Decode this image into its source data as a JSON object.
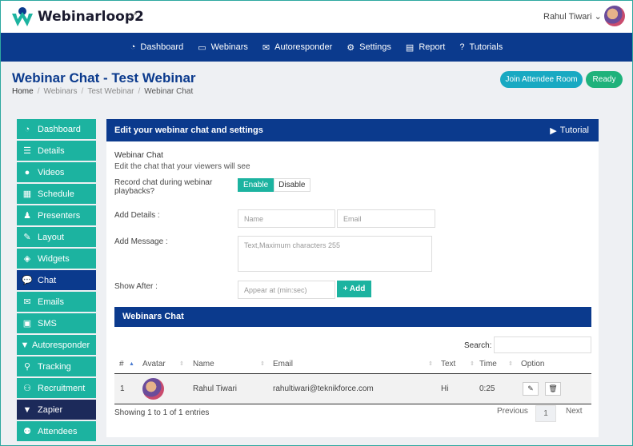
{
  "app": {
    "name": "Webinarloop2",
    "user": "Rahul Tiwari"
  },
  "nav": [
    {
      "label": "Dashboard",
      "icon": "dashboard-icon"
    },
    {
      "label": "Webinars",
      "icon": "webinars-icon"
    },
    {
      "label": "Autoresponder",
      "icon": "envelope-icon"
    },
    {
      "label": "Settings",
      "icon": "gear-icon"
    },
    {
      "label": "Report",
      "icon": "report-icon"
    },
    {
      "label": "Tutorials",
      "icon": "question-icon"
    }
  ],
  "header": {
    "title": "Webinar Chat - Test Webinar",
    "breadcrumb": [
      "Home",
      "Webinars",
      "Test Webinar",
      "Webinar Chat"
    ],
    "join_label": "Join Attendee Room",
    "ready_label": "Ready"
  },
  "sidebar": [
    {
      "label": "Dashboard",
      "icon": "dashboard-icon"
    },
    {
      "label": "Details",
      "icon": "list-icon"
    },
    {
      "label": "Videos",
      "icon": "video-icon"
    },
    {
      "label": "Schedule",
      "icon": "calendar-icon"
    },
    {
      "label": "Presenters",
      "icon": "presenter-icon"
    },
    {
      "label": "Layout",
      "icon": "edit-icon"
    },
    {
      "label": "Widgets",
      "icon": "layers-icon"
    },
    {
      "label": "Chat",
      "icon": "chat-icon"
    },
    {
      "label": "Emails",
      "icon": "envelope-icon"
    },
    {
      "label": "SMS",
      "icon": "sms-icon"
    },
    {
      "label": "Autoresponder",
      "icon": "funnel-icon"
    },
    {
      "label": "Tracking",
      "icon": "pin-icon"
    },
    {
      "label": "Recruitment",
      "icon": "recruitment-icon"
    },
    {
      "label": "Zapier",
      "icon": "funnel-icon"
    },
    {
      "label": "Attendees",
      "icon": "attendees-icon"
    }
  ],
  "panel": {
    "title": "Edit your webinar chat and settings",
    "tutorial_label": "Tutorial",
    "section_title": "Webinar Chat",
    "section_sub": "Edit the chat that your viewers will see",
    "record_label_1": "Record chat during webinar",
    "record_label_2": "playbacks?",
    "enable_label": "Enable",
    "disable_label": "Disable",
    "details_label": "Add Details :",
    "name_placeholder": "Name",
    "email_placeholder": "Email",
    "message_label": "Add Message :",
    "message_placeholder": "Text,Maximum characters 255",
    "show_after_label": "Show After :",
    "show_after_placeholder": "Appear at (min:sec)",
    "add_label": "+ Add"
  },
  "chat_table": {
    "title": "Webinars Chat",
    "search_label": "Search:",
    "columns": [
      "#",
      "Avatar",
      "Name",
      "Email",
      "Text",
      "Time",
      "Option"
    ],
    "rows": [
      {
        "num": "1",
        "name": "Rahul Tiwari",
        "email": "rahultiwari@teknikforce.com",
        "text": "Hi",
        "time": "0:25"
      }
    ],
    "showing": "Showing 1 to 1 of 1 entries",
    "prev": "Previous",
    "page": "1",
    "next": "Next"
  }
}
